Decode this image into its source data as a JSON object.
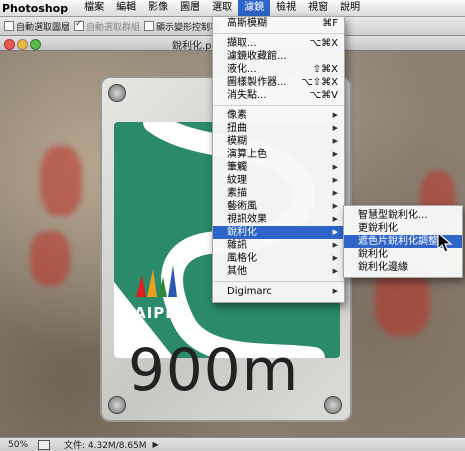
{
  "app": {
    "name": "Photoshop"
  },
  "menubar": [
    {
      "label": "檔案"
    },
    {
      "label": "編輯"
    },
    {
      "label": "影像"
    },
    {
      "label": "圖層"
    },
    {
      "label": "選取"
    },
    {
      "label": "濾鏡"
    },
    {
      "label": "檢視"
    },
    {
      "label": "視窗"
    },
    {
      "label": "說明"
    }
  ],
  "options": {
    "auto_select_layer": "自動選取圖層",
    "auto_select_group": "自動選取群組",
    "show_transform": "顯示變形控制項"
  },
  "document": {
    "title": "銳利化.psd"
  },
  "sign": {
    "brand": "TAIPEI",
    "distance": "900m"
  },
  "filter_menu": {
    "top": [
      {
        "label": "高斯模糊",
        "shortcut": "⌘F"
      }
    ],
    "group2": [
      {
        "label": "擷取...",
        "shortcut": "⌥⌘X"
      },
      {
        "label": "濾鏡收藏館..."
      },
      {
        "label": "液化...",
        "shortcut": "⇧⌘X"
      },
      {
        "label": "圖樣製作器...",
        "shortcut": "⌥⇧⌘X"
      },
      {
        "label": "消失點...",
        "shortcut": "⌥⌘V"
      }
    ],
    "group3": [
      {
        "label": "像素"
      },
      {
        "label": "扭曲"
      },
      {
        "label": "模糊"
      },
      {
        "label": "演算上色"
      },
      {
        "label": "筆觸"
      },
      {
        "label": "紋理"
      },
      {
        "label": "素描"
      },
      {
        "label": "藝術風"
      },
      {
        "label": "視訊效果"
      },
      {
        "label": "銳利化"
      },
      {
        "label": "雜訊"
      },
      {
        "label": "風格化"
      },
      {
        "label": "其他"
      }
    ],
    "group4": [
      {
        "label": "Digimarc"
      }
    ]
  },
  "sharpen_submenu": [
    {
      "label": "智慧型銳利化..."
    },
    {
      "label": "更銳利化"
    },
    {
      "label": "遮色片銳利化調整..."
    },
    {
      "label": "銳利化"
    },
    {
      "label": "銳利化邊緣"
    }
  ],
  "status": {
    "zoom": "50%",
    "doc_info": "文件: 4.32M/8.65M"
  },
  "colors": {
    "highlight": "#2f64c8",
    "sign_green": "#2a8a6a"
  }
}
